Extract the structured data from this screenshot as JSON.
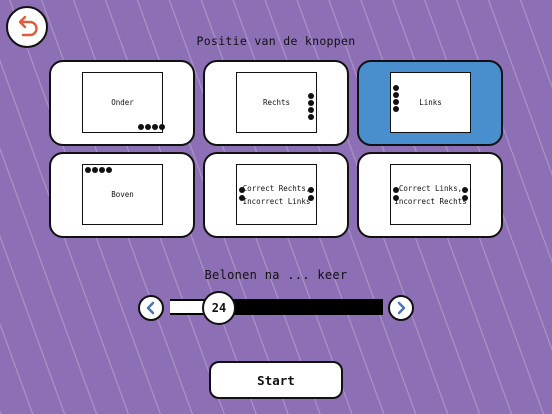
{
  "header": {
    "title": "Positie van de knoppen"
  },
  "options": [
    {
      "label": "Onder"
    },
    {
      "label": "Rechts"
    },
    {
      "label": "Links"
    },
    {
      "label": "Boven"
    },
    {
      "label_line1": "Correct Rechts,",
      "label_line2": "Incorrect Links"
    },
    {
      "label_line1": "Correct Links,",
      "label_line2": "Incorrect Rechts"
    }
  ],
  "selected_option": "Links",
  "reward": {
    "label": "Belonen na ... keer",
    "value": "24",
    "fraction": 0.17
  },
  "start_label": "Start",
  "colors": {
    "background": "#8c6fb4",
    "selected": "#4a8fcd",
    "arrow": "#4a73b8",
    "back_arrow": "#e05a3f"
  },
  "icons": {
    "back": "undo-arrow-icon",
    "prev": "chevron-left-icon",
    "next": "chevron-right-icon"
  }
}
